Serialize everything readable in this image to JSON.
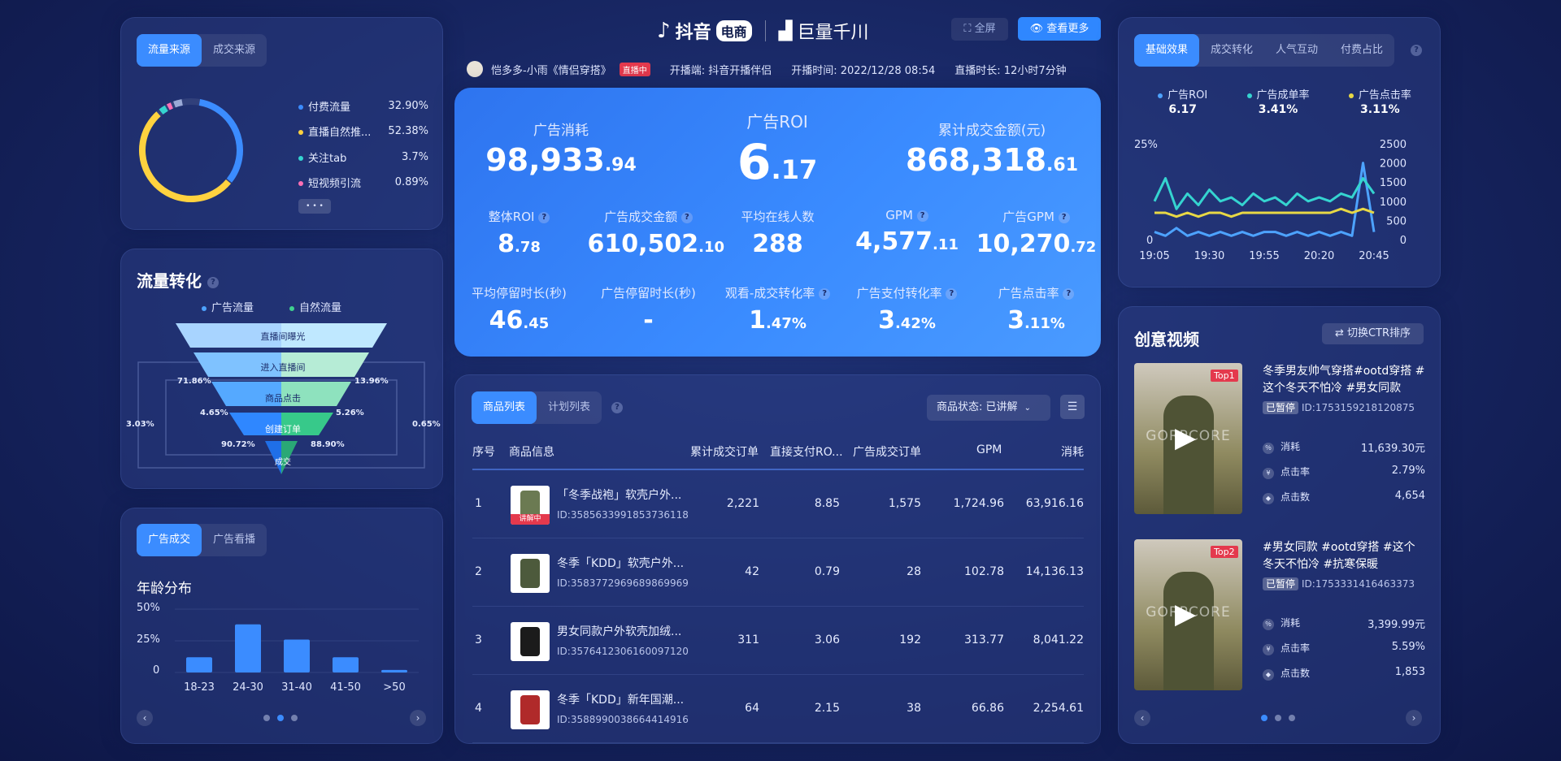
{
  "header": {
    "brand_douyin": "抖音",
    "brand_ecom": "电商",
    "brand_julian": "巨量千川",
    "fullscreen": "全屏",
    "view_more": "查看更多",
    "streamer": "恺多多-小雨《情侣穿搭》",
    "live_badge": "直播中",
    "platform": "开播端: 抖音开播伴侣",
    "start_time": "开播时间: 2022/12/28 08:54",
    "duration": "直播时长: 12小时7分钟"
  },
  "traffic_source": {
    "tabs": [
      "流量来源",
      "成交来源"
    ],
    "items": [
      {
        "label": "付费流量",
        "value": "32.90%",
        "color": "#3b8cff"
      },
      {
        "label": "直播自然推...",
        "value": "52.38%",
        "color": "#ffd23f"
      },
      {
        "label": "关注tab",
        "value": "3.7%",
        "color": "#35d4d0"
      },
      {
        "label": "短视频引流",
        "value": "0.89%",
        "color": "#ff6fb5"
      }
    ],
    "more": "• • •"
  },
  "funnel": {
    "title": "流量转化",
    "legend": [
      "广告流量",
      "自然流量"
    ],
    "stages": [
      "直播间曝光",
      "进入直播间",
      "商品点击",
      "创建订单",
      "成交"
    ],
    "left_rates": [
      "71.86%",
      "4.65%",
      "90.72%"
    ],
    "right_rates": [
      "13.96%",
      "5.26%",
      "88.90%"
    ],
    "outer_left": "3.03%",
    "outer_right": "0.65%"
  },
  "age": {
    "tabs": [
      "广告成交",
      "广告看播"
    ],
    "title": "年龄分布",
    "y_ticks": [
      "50%",
      "25%",
      "0"
    ]
  },
  "chart_data": [
    {
      "type": "bar",
      "title": "年龄分布",
      "categories": [
        "18-23",
        "24-30",
        "31-40",
        "41-50",
        ">50"
      ],
      "values": [
        12,
        38,
        26,
        12,
        2
      ],
      "ylim": [
        0,
        50
      ]
    },
    {
      "type": "line",
      "x": [
        "19:05",
        "19:30",
        "19:55",
        "20:20",
        "20:45"
      ],
      "series": [
        {
          "name": "广告ROI",
          "color": "#4da3ff",
          "values": [
            2,
            1,
            3,
            1,
            2,
            1,
            2,
            1,
            2,
            1,
            2,
            2,
            1,
            2,
            1,
            2,
            1,
            2,
            1,
            20,
            2
          ]
        },
        {
          "name": "广告成单率",
          "color": "#35d4d0",
          "values": [
            10,
            16,
            8,
            12,
            9,
            13,
            10,
            11,
            9,
            12,
            10,
            11,
            9,
            12,
            10,
            11,
            10,
            12,
            11,
            16,
            12
          ]
        },
        {
          "name": "广告点击率",
          "color": "#e8d845",
          "values": [
            7,
            7,
            6,
            7,
            6,
            7,
            7,
            6,
            7,
            7,
            7,
            7,
            7,
            7,
            7,
            7,
            7,
            8,
            7,
            8,
            7
          ]
        }
      ],
      "left_ticks": [
        "25%",
        "0"
      ],
      "right_ticks": [
        "2500",
        "2000",
        "1500",
        "1000",
        "500",
        "0"
      ],
      "ylim": [
        0,
        25
      ]
    }
  ],
  "kpi": {
    "ad_spend_label": "广告消耗",
    "ad_spend_int": "98,933",
    "ad_spend_dec": ".94",
    "roi_label": "广告ROI",
    "roi_int": "6",
    "roi_dec": ".17",
    "gmv_label": "累计成交金额(元)",
    "gmv_int": "868,318",
    "gmv_dec": ".61",
    "row2": [
      {
        "label": "整体ROI",
        "int": "8",
        "dec": ".78",
        "help": true
      },
      {
        "label": "广告成交金额",
        "int": "610,502",
        "dec": ".10",
        "help": true
      },
      {
        "label": "平均在线人数",
        "int": "288",
        "dec": "",
        "help": false
      },
      {
        "label": "GPM",
        "int": "4,577",
        "dec": ".11",
        "help": true
      },
      {
        "label": "广告GPM",
        "int": "10,270",
        "dec": ".72",
        "help": true
      }
    ],
    "row3": [
      {
        "label": "平均停留时长(秒)",
        "int": "46",
        "dec": ".45",
        "help": false
      },
      {
        "label": "广告停留时长(秒)",
        "int": "-",
        "dec": "",
        "help": false
      },
      {
        "label": "观看-成交转化率",
        "int": "1",
        "dec": ".47%",
        "help": true
      },
      {
        "label": "广告支付转化率",
        "int": "3",
        "dec": ".42%",
        "help": true
      },
      {
        "label": "广告点击率",
        "int": "3",
        "dec": ".11%",
        "help": true
      }
    ]
  },
  "products": {
    "tabs": [
      "商品列表",
      "计划列表"
    ],
    "status_filter": "商品状态: 已讲解",
    "headers": [
      "序号",
      "商品信息",
      "累计成交订单",
      "直接支付RO...",
      "广告成交订单",
      "GPM",
      "消耗"
    ],
    "rows": [
      {
        "idx": "1",
        "name": "「冬季战袍」软壳户外...",
        "id": "ID:3585633991853736118",
        "badge": "讲解中",
        "orders": "2,221",
        "roi": "8.85",
        "ad_orders": "1,575",
        "gpm": "1,724.96",
        "spend": "63,916.16"
      },
      {
        "idx": "2",
        "name": "冬季「KDD」软壳户外...",
        "id": "ID:3583772969689869969",
        "badge": "",
        "orders": "42",
        "roi": "0.79",
        "ad_orders": "28",
        "gpm": "102.78",
        "spend": "14,136.13"
      },
      {
        "idx": "3",
        "name": "男女同款户外软壳加绒...",
        "id": "ID:3576412306160097120",
        "badge": "",
        "orders": "311",
        "roi": "3.06",
        "ad_orders": "192",
        "gpm": "313.77",
        "spend": "8,041.22"
      },
      {
        "idx": "4",
        "name": "冬季「KDD」新年国潮...",
        "id": "ID:3588990038664414916",
        "badge": "",
        "orders": "64",
        "roi": "2.15",
        "ad_orders": "38",
        "gpm": "66.86",
        "spend": "2,254.61"
      }
    ]
  },
  "basic": {
    "tabs": [
      "基础效果",
      "成交转化",
      "人气互动",
      "付费占比"
    ],
    "legend": [
      {
        "label": "广告ROI",
        "value": "6.17"
      },
      {
        "label": "广告成单率",
        "value": "3.41%"
      },
      {
        "label": "广告点击率",
        "value": "3.11%"
      }
    ]
  },
  "creative": {
    "title": "创意视频",
    "switch": "切换CTR排序",
    "videos": [
      {
        "rank": "Top1",
        "title": "冬季男友帅气穿搭#ootd穿搭 #这个冬天不怕冷 #男女同款",
        "status": "已暂停",
        "id": "ID:1753159218120875",
        "spend_label": "消耗",
        "spend": "11,639.30元",
        "ctr_label": "点击率",
        "ctr": "2.79%",
        "clicks_label": "点击数",
        "clicks": "4,654",
        "thumb_text": "GORPCORE"
      },
      {
        "rank": "Top2",
        "title": "#男女同款 #ootd穿搭 #这个冬天不怕冷 #抗寒保暖",
        "status": "已暂停",
        "id": "ID:1753331416463373",
        "spend_label": "消耗",
        "spend": "3,399.99元",
        "ctr_label": "点击率",
        "ctr": "5.59%",
        "clicks_label": "点击数",
        "clicks": "1,853",
        "thumb_text": "GORPCORE"
      }
    ]
  },
  "colors": {
    "accent": "#3b8cff",
    "yellow": "#ffd23f",
    "cyan": "#35d4d0",
    "pink": "#ff6fb5"
  }
}
